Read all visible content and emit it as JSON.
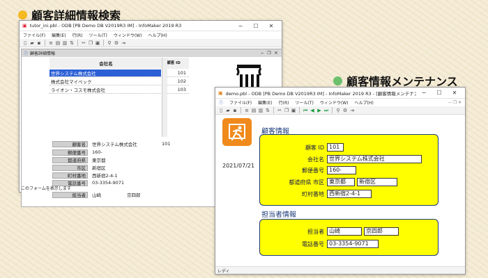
{
  "headings": {
    "left": "顧客詳細情報検索",
    "right": "顧客情報メンテナンス"
  },
  "colors": {
    "left_dot": "#f5b922",
    "right_dot": "#6cc06c",
    "highlight": "#ffff00",
    "selection": "#2a5fd6"
  },
  "left_window": {
    "title": "tutor_ini.pbl - ODB [PB Demo DB V2019R3 IM] - InfoMaker 2019 R3",
    "menu": [
      "ファイル(F)",
      "編集(E)",
      "行(R)",
      "ツール(T)",
      "ウィンドウ(W)",
      "ヘルプ(H)"
    ],
    "inner_title": "顧客詳細情報",
    "grid_header": {
      "company": "会社名",
      "id": "顧客 ID"
    },
    "grid_rows": [
      {
        "company": "世界システム株式会社",
        "id": "101"
      },
      {
        "company": "株式会社マイペック",
        "id": "102"
      },
      {
        "company": "ライオン・コスモ株式会社",
        "id": "103"
      }
    ],
    "detail": {
      "labels": [
        "顧客名",
        "郵便番号",
        "都道府県",
        "市区",
        "町村番地",
        "電話番号",
        "担当者"
      ],
      "values": [
        "世界システム株式会社",
        "160-",
        "東京都",
        "新宿区",
        "西新宿2-4-1",
        "03-3354-9071",
        "山崎"
      ],
      "customer_id": "101",
      "contact_first": "京四郎"
    },
    "status": "このフォームを表示します"
  },
  "right_window": {
    "title": "demo.pbl - ODB [PB Demo DB V2019R3 IM] - InfoMaker 2019 R3 - [顧客情報メンテナンス]",
    "menu": [
      "ファイル(F)",
      "編集(E)",
      "行(R)",
      "ツール(T)",
      "ウィンドウ(W)",
      "ヘルプ(H)"
    ],
    "date": "2021/07/21",
    "section_customer": "顧客情報",
    "section_contact": "担当者情報",
    "fields": {
      "id_label": "顧客 ID",
      "id": "101",
      "company_label": "会社名",
      "company": "世界システム株式会社",
      "zip_label": "郵便番号",
      "zip": "160-",
      "pref_label": "都道府県 市区",
      "pref": "東京都",
      "city": "新宿区",
      "addr_label": "町村番地",
      "addr": "西新宿2-4-1",
      "contact_label": "担当者",
      "contact_last": "山崎",
      "contact_first": "京四郎",
      "phone_label": "電話番号",
      "phone": "03-3354-9071"
    },
    "status": "レディ"
  }
}
